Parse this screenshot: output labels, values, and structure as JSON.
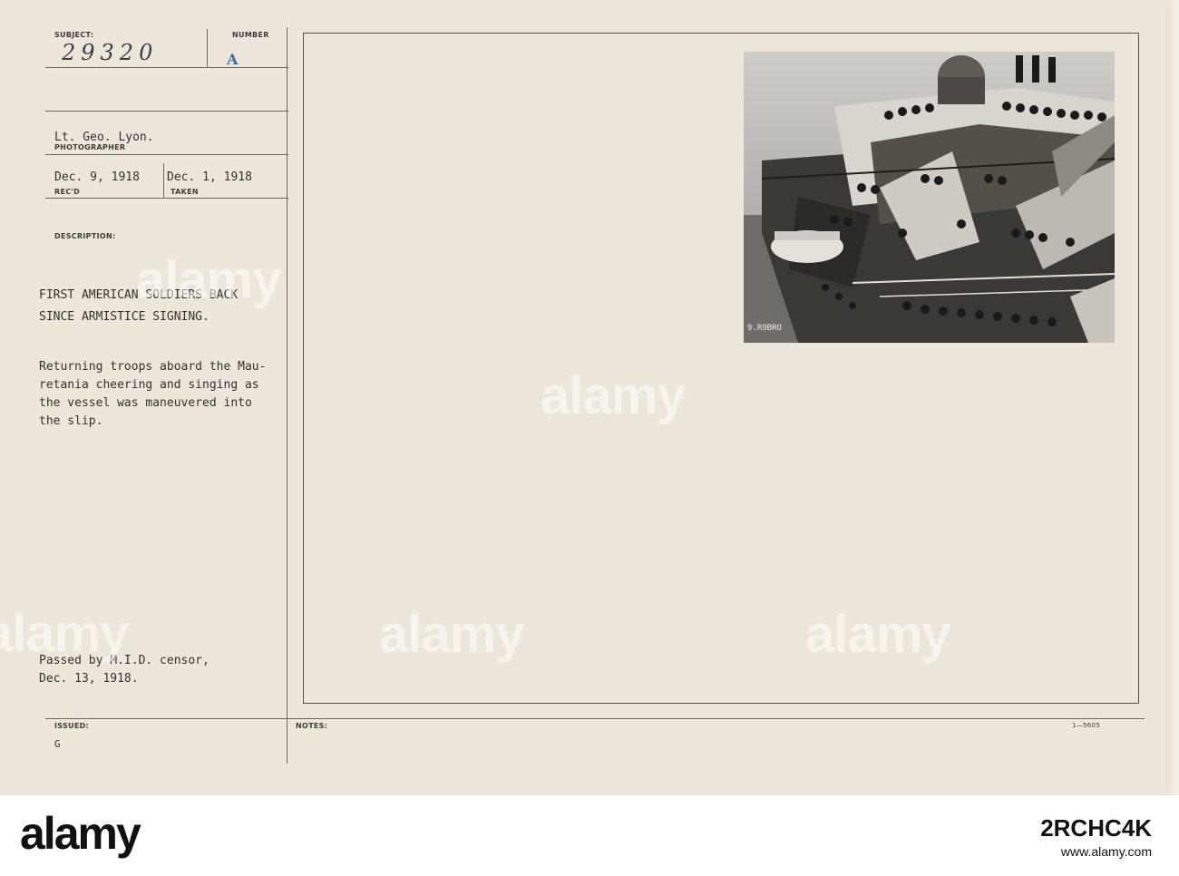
{
  "card": {
    "subject_label": "SUBJECT:",
    "number_label": "NUMBER",
    "subject_number": "29320",
    "number_value": "A",
    "photographer": "Lt. Geo. Lyon.",
    "photographer_label": "PHOTOGRAPHER",
    "received": "Dec. 9, 1918",
    "received_label": "REC'D",
    "taken": "Dec. 1, 1918",
    "taken_label": "TAKEN",
    "description_label": "DESCRIPTION:",
    "headline_line1": "FIRST AMERICAN SOLDIERS BACK",
    "headline_line2": "SINCE ARMISTICE SIGNING.",
    "body_line1": "Returning troops aboard the Mau-",
    "body_line2": "retania cheering and singing as",
    "body_line3": "the vessel was maneuvered into",
    "body_line4": "the slip.",
    "censor_line1": "Passed by M.I.D. censor,",
    "censor_line2": "Dec. 13, 1918.",
    "issued_label": "ISSUED:",
    "issued_value": "G",
    "notes_label": "NOTES:",
    "form_number": "1—5605",
    "photo_marking": "9.R9BRO"
  },
  "watermark": {
    "text": "alamy"
  },
  "footer": {
    "logo": "alamy",
    "image_id": "2RCHC4K",
    "url": "www.alamy.com"
  }
}
